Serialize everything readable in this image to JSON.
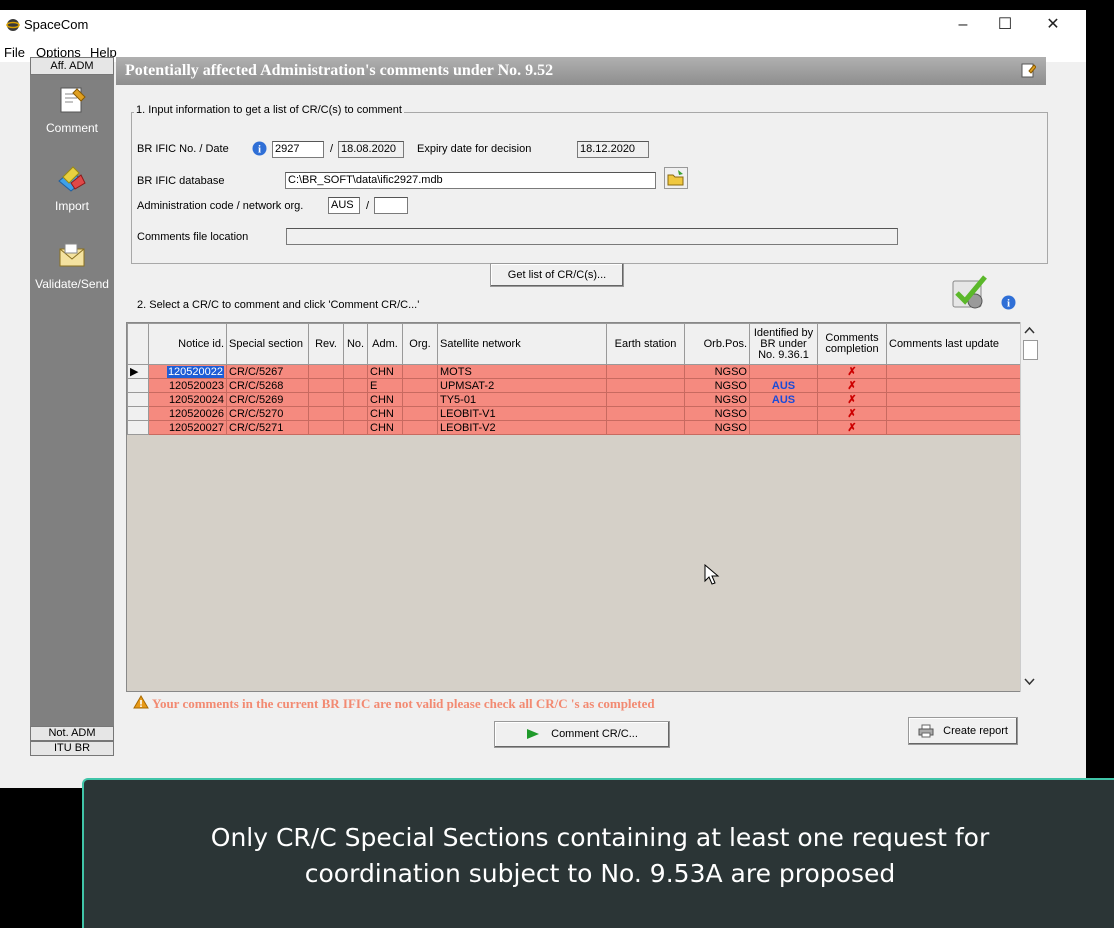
{
  "window": {
    "title": "SpaceCom",
    "controls": {
      "minimize": "–",
      "maximize": "☐",
      "close": "✕"
    }
  },
  "menu": [
    "File",
    "Options",
    "Help"
  ],
  "left_panel": {
    "header": "Aff. ADM",
    "items": [
      {
        "label": "Comment",
        "icon": "comment-icon"
      },
      {
        "label": "Import",
        "icon": "import-icon"
      },
      {
        "label": "Validate/Send",
        "icon": "validate-send-icon"
      }
    ],
    "footer": [
      "Not. ADM",
      "ITU BR"
    ]
  },
  "panel": {
    "title": "Potentially affected Administration's comments under No. 9.52",
    "section1": {
      "title": "1. Input information to get a list of CR/C(s) to comment",
      "bric_label": "BR IFIC No. / Date",
      "bric_no": "2927",
      "date_sep": "/",
      "bric_date": "18.08.2020",
      "expiry_label": "Expiry date for decision",
      "expiry_date": "18.12.2020",
      "db_label": "BR IFIC database",
      "db_path": "C:\\BR_SOFT\\data\\ific2927.mdb",
      "admin_label": "Administration code / network org.",
      "admin_code": "AUS",
      "admin_sep": "/",
      "network_org": "",
      "comments_label": "Comments file location",
      "comments_path": ""
    },
    "get_list_button": "Get list of CR/C(s)...",
    "section2_title": "2. Select a CR/C to comment and click 'Comment CR/C...'",
    "table": {
      "columns": [
        "Notice id.",
        "Special section",
        "Rev.",
        "No.",
        "Adm.",
        "Org.",
        "Satellite network",
        "Earth station",
        "Orb.Pos.",
        "Identified by BR under No. 9.36.1",
        "Comments completion",
        "Comments last update"
      ],
      "rows": [
        {
          "notice": "120520022",
          "section": "CR/C/5267",
          "rev": "",
          "no": "",
          "adm": "CHN",
          "org": "",
          "network": "MOTS",
          "earth": "",
          "orb": "NGSO",
          "identified": "",
          "completion": "✗",
          "last_update": ""
        },
        {
          "notice": "120520023",
          "section": "CR/C/5268",
          "rev": "",
          "no": "",
          "adm": "E",
          "org": "",
          "network": "UPMSAT-2",
          "earth": "",
          "orb": "NGSO",
          "identified": "AUS",
          "completion": "✗",
          "last_update": ""
        },
        {
          "notice": "120520024",
          "section": "CR/C/5269",
          "rev": "",
          "no": "",
          "adm": "CHN",
          "org": "",
          "network": "TY5-01",
          "earth": "",
          "orb": "NGSO",
          "identified": "AUS",
          "completion": "✗",
          "last_update": ""
        },
        {
          "notice": "120520026",
          "section": "CR/C/5270",
          "rev": "",
          "no": "",
          "adm": "CHN",
          "org": "",
          "network": "LEOBIT-V1",
          "earth": "",
          "orb": "NGSO",
          "identified": "",
          "completion": "✗",
          "last_update": ""
        },
        {
          "notice": "120520027",
          "section": "CR/C/5271",
          "rev": "",
          "no": "",
          "adm": "CHN",
          "org": "",
          "network": "LEOBIT-V2",
          "earth": "",
          "orb": "NGSO",
          "identified": "",
          "completion": "✗",
          "last_update": ""
        }
      ]
    },
    "warning": "Your comments in the current BR IFIC are not valid please check all  CR/C 's as completed",
    "comment_button": "Comment CR/C...",
    "report_button": "Create report"
  },
  "caption": {
    "line1": "Only CR/C Special Sections containing at least one request for",
    "line2": "coordination subject to No. 9.53A are proposed"
  },
  "colors": {
    "row_bg": "#f58a7f",
    "header_bg": "#9a9a9a",
    "caption_border": "#40c4a8",
    "identified_text": "#1a4bd8"
  }
}
